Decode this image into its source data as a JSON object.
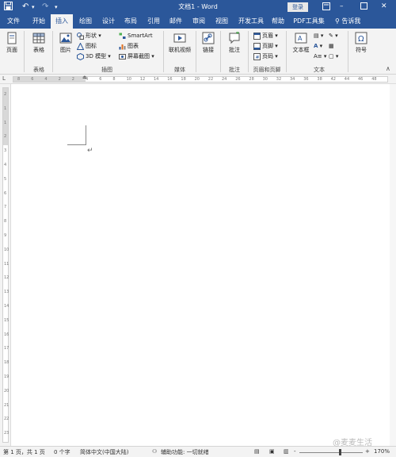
{
  "window": {
    "title": "文档1 - Word",
    "login_label": "登录",
    "quick_access": [
      "save-icon",
      "undo-icon",
      "redo-icon",
      "customize-icon"
    ],
    "controls": [
      "restore-ribbon-icon",
      "minimize-icon",
      "maximize-icon",
      "close-icon"
    ]
  },
  "tabs": [
    {
      "label": "文件"
    },
    {
      "label": "开始"
    },
    {
      "label": "插入"
    },
    {
      "label": "绘图"
    },
    {
      "label": "设计"
    },
    {
      "label": "布局"
    },
    {
      "label": "引用"
    },
    {
      "label": "邮件"
    },
    {
      "label": "审阅"
    },
    {
      "label": "视图"
    },
    {
      "label": "开发工具"
    },
    {
      "label": "帮助"
    },
    {
      "label": "PDF工具集"
    }
  ],
  "active_tab": "插入",
  "tell_me": "告诉我",
  "ribbon": {
    "pages": {
      "button": "页面",
      "group": ""
    },
    "tables": {
      "button": "表格",
      "group": "表格"
    },
    "illustrations": {
      "group": "插图",
      "picture": "图片",
      "shapes": "形状",
      "icons": "图标",
      "models3d": "3D 模型",
      "smartart": "SmartArt",
      "chart": "图表",
      "screenshot": "屏幕截图"
    },
    "media": {
      "group": "媒体",
      "online_video": "联机视频"
    },
    "links": {
      "group": "",
      "link": "链接"
    },
    "comments": {
      "group": "批注",
      "comment": "批注"
    },
    "header_footer": {
      "group": "页眉和页脚",
      "header": "页眉",
      "footer": "页脚",
      "page_number": "页码"
    },
    "text": {
      "group": "文本",
      "textbox": "文本框"
    },
    "symbols": {
      "group": "",
      "symbol": "符号"
    }
  },
  "ruler": {
    "h_numbers": [
      "8",
      "6",
      "4",
      "2",
      "2",
      "4",
      "6",
      "8",
      "10",
      "12",
      "14",
      "16",
      "18",
      "20",
      "22",
      "24",
      "26",
      "28",
      "30",
      "32",
      "34",
      "36",
      "38",
      "42",
      "44",
      "46",
      "48"
    ],
    "v_numbers": [
      "2",
      "1",
      "1",
      "2",
      "3",
      "4",
      "5",
      "6",
      "7",
      "8",
      "9",
      "10",
      "11",
      "12",
      "13",
      "14",
      "15",
      "16",
      "17",
      "18",
      "19",
      "20",
      "21",
      "22",
      "23"
    ]
  },
  "status": {
    "page": "第 1 页，共 1 页",
    "words": "0 个字",
    "language": "简体中文(中国大陆)",
    "accessibility": "辅助功能: 一切就绪",
    "zoom": "170%",
    "zoom_minus": "-",
    "zoom_plus": "+"
  },
  "watermark": "@麦麦生活",
  "colors": {
    "accent": "#2b579a",
    "ribbon_bg": "#f3f3f3"
  }
}
